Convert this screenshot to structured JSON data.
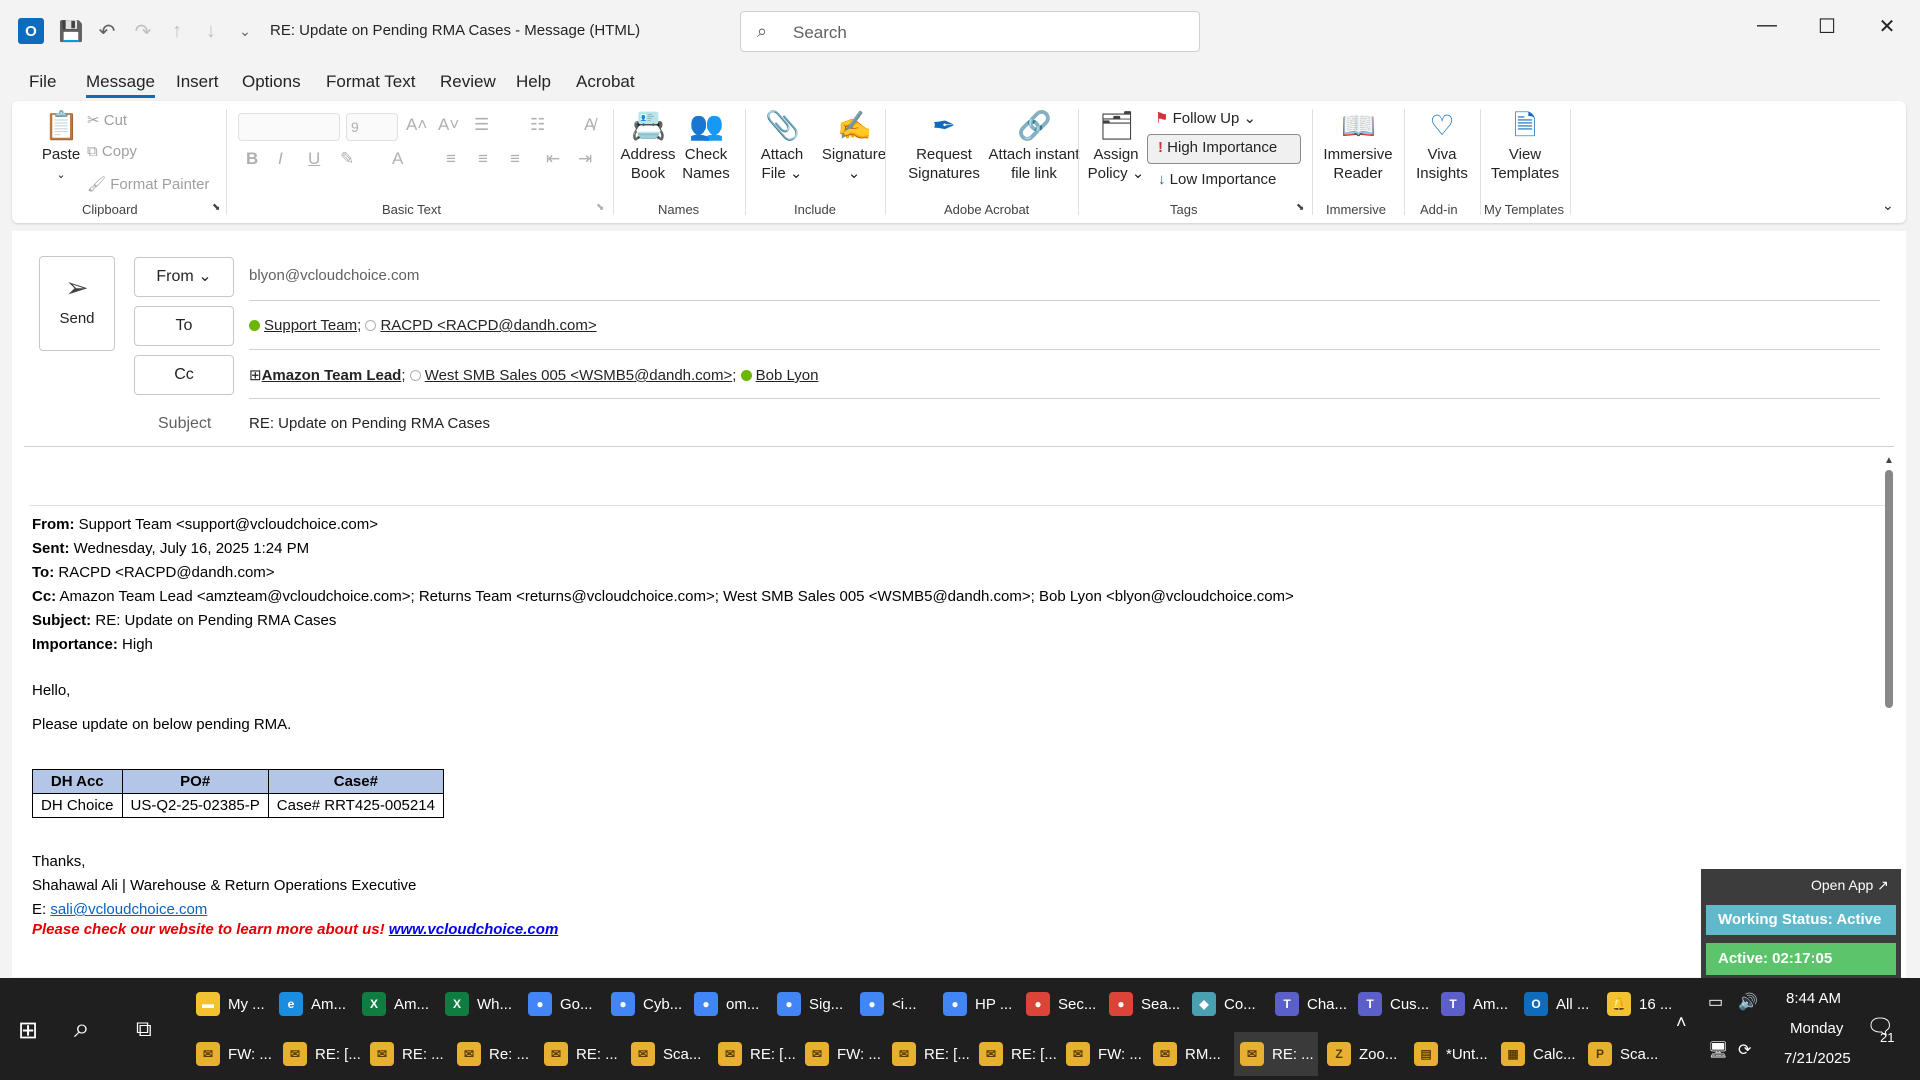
{
  "window": {
    "title": "RE: Update on Pending RMA Cases  -  Message (HTML)",
    "search_placeholder": "Search"
  },
  "menu": [
    "File",
    "Message",
    "Insert",
    "Options",
    "Format Text",
    "Review",
    "Help",
    "Acrobat"
  ],
  "ribbon": {
    "paste": "Paste",
    "cut": "Cut",
    "copy": "Copy",
    "format_painter": "Format Painter",
    "font_size": "9",
    "groups": {
      "clipboard": "Clipboard",
      "basic_text": "Basic Text",
      "names": "Names",
      "include": "Include",
      "adobe_acrobat": "Adobe Acrobat",
      "tags": "Tags",
      "immersive": "Immersive",
      "addin": "Add-in",
      "templates": "My Templates"
    },
    "address_book": [
      "Address",
      "Book"
    ],
    "check_names": [
      "Check",
      "Names"
    ],
    "attach_file": [
      "Attach",
      "File ⌄"
    ],
    "signature": [
      "Signature",
      "⌄"
    ],
    "request_signatures": [
      "Request",
      "Signatures"
    ],
    "attach_instant": [
      "Attach instant",
      "file link"
    ],
    "assign_policy": [
      "Assign",
      "Policy ⌄"
    ],
    "follow_up": "Follow Up ⌄",
    "high_importance": "High Importance",
    "low_importance": "Low Importance",
    "immersive_reader": [
      "Immersive",
      "Reader"
    ],
    "viva_insights": [
      "Viva",
      "Insights"
    ],
    "view_templates": [
      "View",
      "Templates"
    ]
  },
  "compose": {
    "send": "Send",
    "from_label": "From",
    "from_value": "blyon@vcloudchoice.com",
    "to_label": "To",
    "to": [
      {
        "name": "Support Team",
        "status": "green",
        "sep": ";"
      },
      {
        "name": "RACPD <RACPD@dandh.com>",
        "status": "empty",
        "sep": ""
      }
    ],
    "cc_label": "Cc",
    "cc": [
      {
        "name": "Amazon Team Lead",
        "status": "group",
        "sep": ";"
      },
      {
        "name": "West SMB Sales 005 <WSMB5@dandh.com>",
        "status": "empty",
        "sep": ";"
      },
      {
        "name": "Bob Lyon",
        "status": "green",
        "sep": ""
      }
    ],
    "subject_label": "Subject",
    "subject_value": "RE: Update on Pending RMA Cases"
  },
  "message": {
    "from_label": "From:",
    "from": "Support Team <support@vcloudchoice.com>",
    "sent_label": "Sent:",
    "sent": "Wednesday, July 16, 2025 1:24 PM",
    "to_label": "To:",
    "to": "RACPD <RACPD@dandh.com>",
    "cc_label": "Cc:",
    "cc": "Amazon Team Lead <amzteam@vcloudchoice.com>; Returns Team <returns@vcloudchoice.com>; West SMB Sales 005 <WSMB5@dandh.com>; Bob Lyon <blyon@vcloudchoice.com>",
    "subject_label": "Subject:",
    "subject": "RE: Update on Pending RMA Cases",
    "importance_label": "Importance:",
    "importance": "High",
    "greeting": "Hello,",
    "line1": "Please update on below pending RMA.",
    "table": {
      "headers": [
        "DH Acc",
        "PO#",
        "Case#"
      ],
      "rows": [
        [
          "DH Choice",
          "US-Q2-25-02385-P",
          "Case# RRT425-005214"
        ]
      ]
    },
    "thanks": "Thanks,",
    "signature_name": "Shahawal Ali | Warehouse & Return Operations Executive",
    "email_prefix": "E: ",
    "email": "sali@vcloudchoice.com",
    "website_text": "Please check our website to learn more about us!",
    "website_link": "www.vcloudchoice.com"
  },
  "widget": {
    "open_app": "Open App ↗",
    "status": "Working Status: Active",
    "active": "Active: 02:17:05"
  },
  "taskbar": {
    "row1": [
      {
        "label": "My ...",
        "icon": "folder-icon",
        "color": "#f2c230"
      },
      {
        "label": "Am...",
        "icon": "edge-icon",
        "color": "#1b8de0"
      },
      {
        "label": "Am...",
        "icon": "excel-icon",
        "color": "#107c41"
      },
      {
        "label": "Wh...",
        "icon": "excel-icon",
        "color": "#107c41"
      },
      {
        "label": "Go...",
        "icon": "chrome-icon",
        "color": "#4285f4"
      },
      {
        "label": "Cyb...",
        "icon": "chrome-icon",
        "color": "#4285f4"
      },
      {
        "label": "om...",
        "icon": "chrome-icon",
        "color": "#4285f4"
      },
      {
        "label": "Sig...",
        "icon": "chrome-icon",
        "color": "#4285f4"
      },
      {
        "label": "<i...",
        "icon": "chrome-icon",
        "color": "#4285f4"
      },
      {
        "label": "HP ...",
        "icon": "chrome-icon",
        "color": "#4285f4"
      },
      {
        "label": "Sec...",
        "icon": "chrome-icon",
        "color": "#db4437"
      },
      {
        "label": "Sea...",
        "icon": "chrome-icon",
        "color": "#db4437"
      },
      {
        "label": "Co...",
        "icon": "app-icon",
        "color": "#4aa0b0"
      },
      {
        "label": "Cha...",
        "icon": "teams-icon",
        "color": "#5b5fc7"
      },
      {
        "label": "Cus...",
        "icon": "teams-icon",
        "color": "#5b5fc7"
      },
      {
        "label": "Am...",
        "icon": "teams-icon",
        "color": "#5b5fc7"
      },
      {
        "label": "All ...",
        "icon": "outlook-icon",
        "color": "#0f6cbd"
      },
      {
        "label": "16 ...",
        "icon": "bell-icon",
        "color": "#f2c230"
      }
    ],
    "row2": [
      {
        "label": "FW: ...",
        "icon": "mail-icon"
      },
      {
        "label": "RE: [...",
        "icon": "mail-icon"
      },
      {
        "label": "RE: ...",
        "icon": "mail-icon"
      },
      {
        "label": "Re: ...",
        "icon": "mail-icon"
      },
      {
        "label": "RE: ...",
        "icon": "mail-icon"
      },
      {
        "label": "Sca...",
        "icon": "mail-icon"
      },
      {
        "label": "RE: [...",
        "icon": "mail-icon"
      },
      {
        "label": "FW: ...",
        "icon": "mail-icon"
      },
      {
        "label": "RE: [...",
        "icon": "mail-icon"
      },
      {
        "label": "RE: [...",
        "icon": "mail-icon"
      },
      {
        "label": "FW: ...",
        "icon": "mail-icon"
      },
      {
        "label": "RM...",
        "icon": "mail-icon"
      },
      {
        "label": "RE: ...",
        "icon": "mail-icon"
      },
      {
        "label": "Zoo...",
        "icon": "zoom-icon"
      },
      {
        "label": "*Unt...",
        "icon": "notepad-icon"
      },
      {
        "label": "Calc...",
        "icon": "calculator-icon"
      },
      {
        "label": "Sca...",
        "icon": "pdf-icon"
      }
    ],
    "time": "8:44 AM",
    "day": "Monday",
    "date": "7/21/2025",
    "notifications": "21"
  }
}
